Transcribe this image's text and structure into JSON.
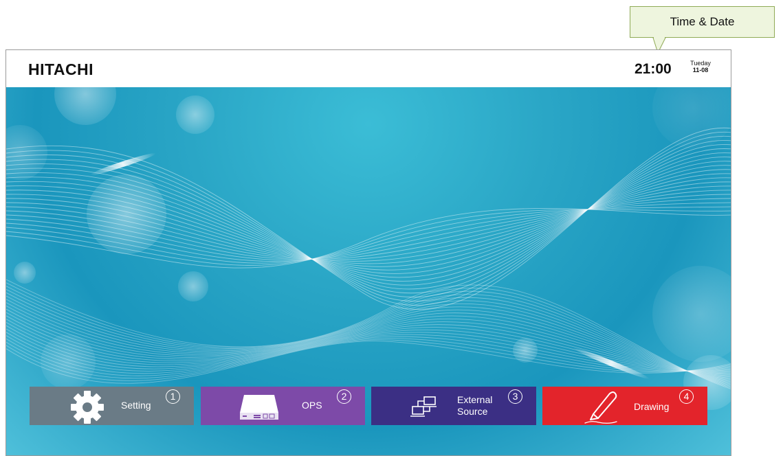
{
  "callout": {
    "label": "Time & Date"
  },
  "header": {
    "brand": "HITACHI",
    "time": "21:00",
    "day": "Tueday",
    "date": "11-08"
  },
  "tiles": [
    {
      "label": "Setting",
      "number": "1",
      "icon": "gear-icon",
      "color": "#6a7b86"
    },
    {
      "label": "OPS",
      "number": "2",
      "icon": "ops-device-icon",
      "color": "#7d4aa8"
    },
    {
      "label_line1": "External",
      "label_line2": "Source",
      "number": "3",
      "icon": "external-source-icon",
      "color": "#3b2f84"
    },
    {
      "label": "Drawing",
      "number": "4",
      "icon": "pen-icon",
      "color": "#e3242b"
    }
  ]
}
